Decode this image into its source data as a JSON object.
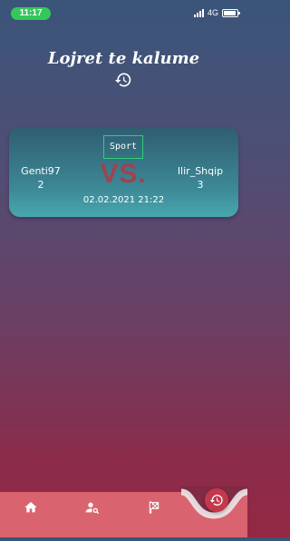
{
  "status_bar": {
    "time": "11:17",
    "network": "4G"
  },
  "header": {
    "title": "Lojret te kalume"
  },
  "match": {
    "category": "Sport",
    "vs_label": "VS.",
    "player1": {
      "name": "Genti97",
      "score": "2"
    },
    "player2": {
      "name": "Ilir_Shqip",
      "score": "3"
    },
    "date": "02.02.2021 21:22"
  },
  "nav": {
    "items": [
      "home-icon",
      "search-user-icon",
      "flag-icon",
      "history-icon"
    ]
  },
  "colors": {
    "nav_bg": "#d9646f",
    "fab": "#c3394b",
    "accent_green": "#34c759",
    "category_border": "#2fcf78"
  }
}
